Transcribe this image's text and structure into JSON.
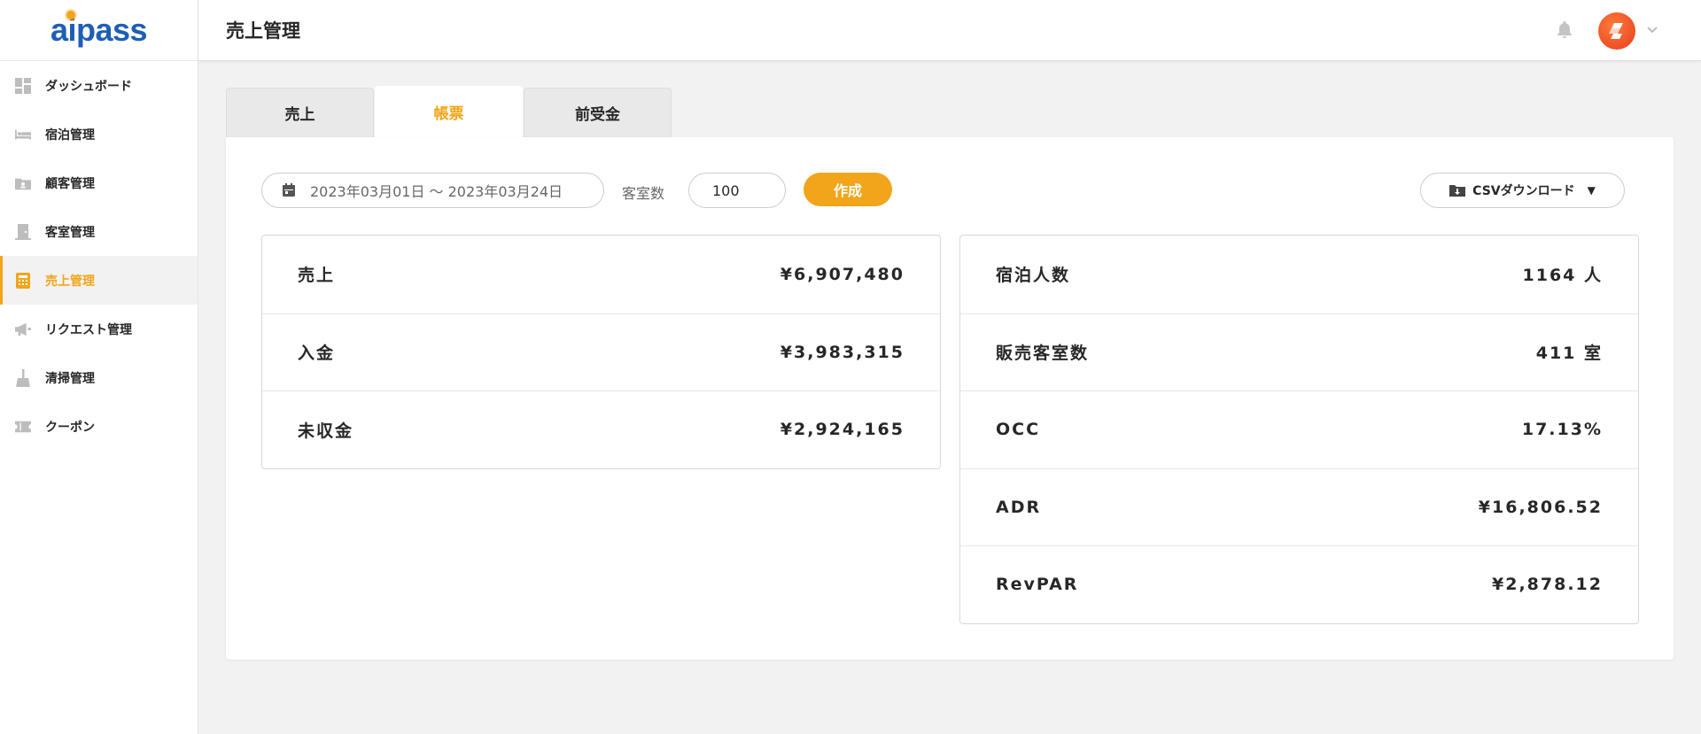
{
  "app": {
    "logo_text": "aipass",
    "page_title": "売上管理"
  },
  "sidebar": {
    "items": [
      {
        "label": "ダッシュボード",
        "icon": "dashboard-icon"
      },
      {
        "label": "宿泊管理",
        "icon": "bed-icon"
      },
      {
        "label": "顧客管理",
        "icon": "customer-folder-icon"
      },
      {
        "label": "客室管理",
        "icon": "door-icon"
      },
      {
        "label": "売上管理",
        "icon": "calculator-icon",
        "active": true
      },
      {
        "label": "リクエスト管理",
        "icon": "megaphone-icon"
      },
      {
        "label": "清掃管理",
        "icon": "broom-icon"
      },
      {
        "label": "クーポン",
        "icon": "ticket-icon"
      }
    ]
  },
  "tabs": [
    {
      "label": "売上"
    },
    {
      "label": "帳票",
      "active": true
    },
    {
      "label": "前受金"
    }
  ],
  "filters": {
    "date_range": "2023年03月01日 ～  2023年03月24日",
    "rooms_label": "客室数",
    "rooms_value": "100",
    "create_label": "作成",
    "csv_label": "CSVダウンロード"
  },
  "left_table": [
    {
      "label": "売上",
      "value": "¥6,907,480"
    },
    {
      "label": "入金",
      "value": "¥3,983,315"
    },
    {
      "label": "未収金",
      "value": "¥2,924,165"
    }
  ],
  "right_table": [
    {
      "label": "宿泊人数",
      "value": "1164 人"
    },
    {
      "label": "販売客室数",
      "value": "411 室"
    },
    {
      "label": "OCC",
      "value": "17.13%"
    },
    {
      "label": "ADR",
      "value": "¥16,806.52"
    },
    {
      "label": "RevPAR",
      "value": "¥2,878.12"
    }
  ],
  "colors": {
    "accent": "#f2a51a",
    "brand": "#1e5eb5",
    "text": "#272727"
  }
}
